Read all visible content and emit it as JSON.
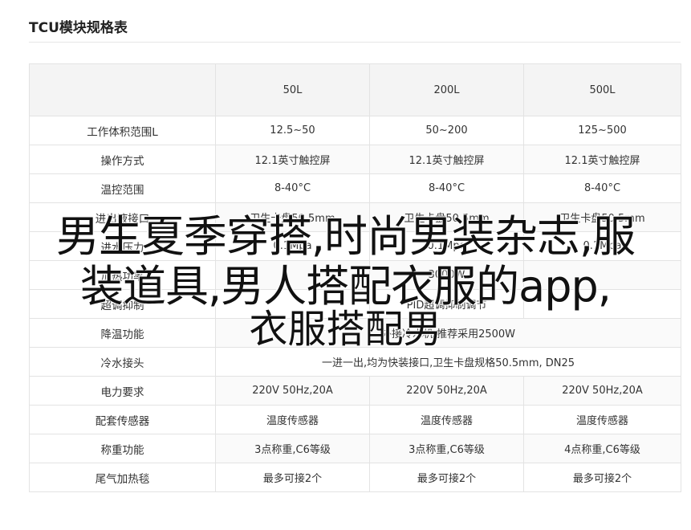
{
  "title": "TCU模块规格表",
  "table": {
    "header": [
      "",
      "50L",
      "200L",
      "500L"
    ],
    "rows": [
      {
        "name": "工作体积范围L",
        "values": [
          "12.5~50",
          "50~200",
          "125~500"
        ]
      },
      {
        "name": "操作方式",
        "values": [
          "12.1英寸触控屏",
          "12.1英寸触控屏",
          "12.1英寸触控屏"
        ]
      },
      {
        "name": "温控范围",
        "values": [
          "8-40°C",
          "8-40°C",
          "8-40°C"
        ]
      },
      {
        "name": "进出液接口",
        "values": [
          "卫生卡盘50.5mm",
          "卫生卡盘50.5mm",
          "卫生卡盘50.5mm"
        ]
      },
      {
        "name": "进水压力",
        "values": [
          "0.1Mpa",
          "0.1Mpa",
          "0.1Mpa"
        ]
      },
      {
        "name": "加热功率",
        "values": [
          "",
          "3000W",
          ""
        ]
      },
      {
        "name": "超调抑制",
        "values": [
          "",
          "PID超调抑制调节",
          ""
        ]
      },
      {
        "name": "降温功能",
        "values": [
          "外接冷水机,推荐采用2500W"
        ]
      },
      {
        "name": "冷水接头",
        "values": [
          "一进一出,均为快装接口,卫生卡盘规格50.5mm, DN25"
        ]
      },
      {
        "name": "电力要求",
        "values": [
          "220V 50Hz,20A",
          "220V 50Hz,20A",
          "220V 50Hz,20A"
        ]
      },
      {
        "name": "配套传感器",
        "values": [
          "温度传感器",
          "温度传感器",
          "温度传感器"
        ]
      },
      {
        "name": "称重功能",
        "values": [
          "3点称重,C6等级",
          "3点称重,C6等级",
          "4点称重,C6等级"
        ]
      },
      {
        "name": "尾气加热毯",
        "values": [
          "最多可接2个",
          "最多可接2个",
          "最多可接2个"
        ]
      }
    ]
  },
  "overlay": {
    "line1": "男生夏季穿搭,时尚男装杂志,服",
    "line2": "装道具,男人搭配衣服的app,",
    "line3": "衣服搭配男"
  }
}
